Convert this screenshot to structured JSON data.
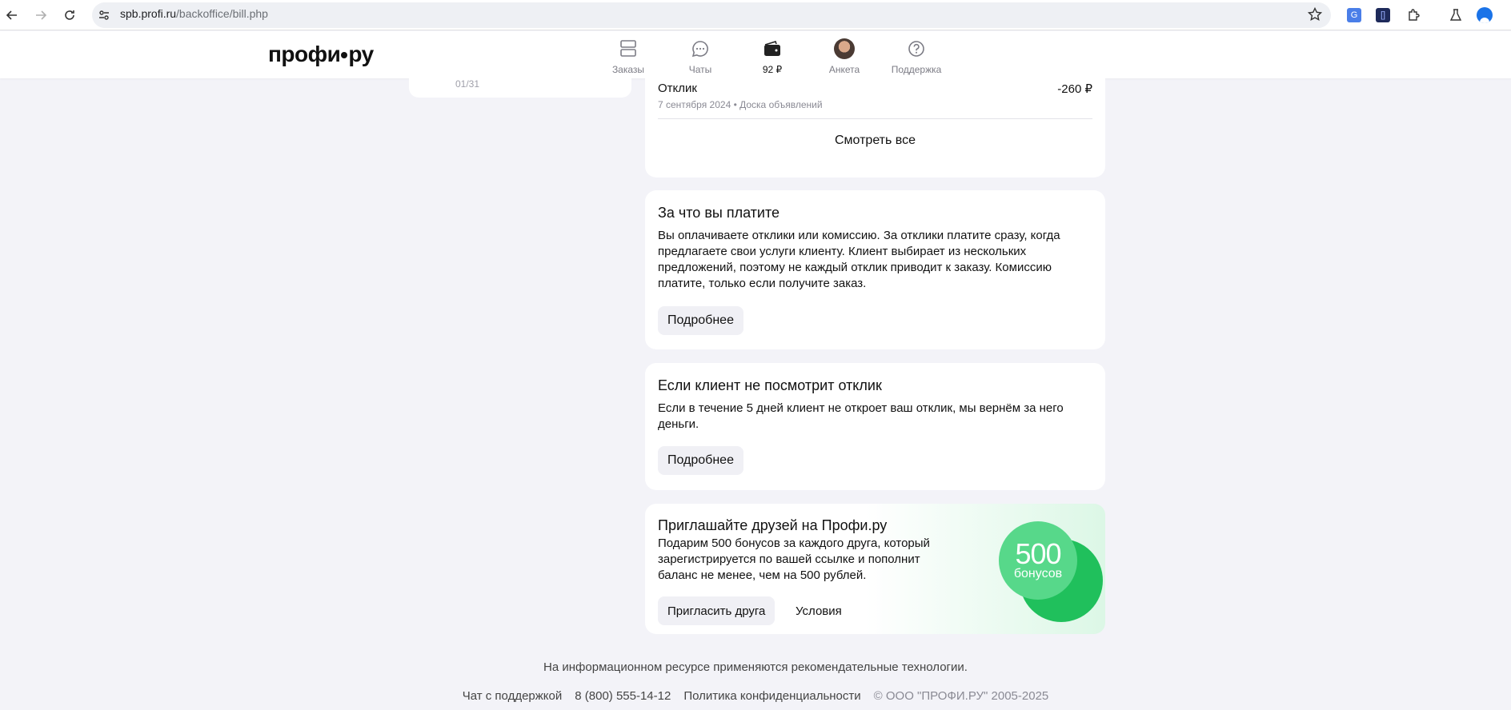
{
  "browser": {
    "url_host": "spb.profi.ru",
    "url_path": "/backoffice/bill.php"
  },
  "header": {
    "logo": "профи.ру",
    "nav": [
      {
        "label": "Заказы",
        "icon": "orders-icon"
      },
      {
        "label": "Чаты",
        "icon": "chat-icon"
      },
      {
        "label": "92 ₽",
        "icon": "wallet-icon"
      },
      {
        "label": "Анкета",
        "icon": "avatar"
      },
      {
        "label": "Поддержка",
        "icon": "help-icon"
      }
    ]
  },
  "left_card": {
    "small_text": "01/31"
  },
  "transactions": {
    "item": {
      "title": "Отклик",
      "amount": "-260 ₽",
      "subtitle": "7 сентября 2024 • Доска объявлений"
    },
    "see_all": "Смотреть все"
  },
  "pay_card": {
    "title": "За что вы платите",
    "body": "Вы оплачиваете отклики или комиссию. За отклики платите сразу, когда предлагаете свои услуги клиенту. Клиент выбирает из нескольких предложений, поэтому не каждый отклик приводит к заказу. Комиссию платите, только если получите заказ.",
    "button": "Подробнее"
  },
  "refund_card": {
    "title": "Если клиент не посмотрит отклик",
    "body": "Если в течение 5 дней клиент не откроет ваш отклик, мы вернём за него деньги.",
    "button": "Подробнее"
  },
  "promo_card": {
    "title": "Приглашайте друзей на Профи.ру",
    "body": "Подарим 500 бонусов за каждого друга, который зарегистрируется по вашей ссылке и пополнит баланс не менее, чем на 500 рублей.",
    "invite_button": "Пригласить друга",
    "terms_button": "Условия",
    "badge_number": "500",
    "badge_word": "бонусов"
  },
  "footer": {
    "note": "На информационном ресурсе применяются рекомендательные технологии.",
    "support_chat": "Чат с поддержкой",
    "phone": "8 (800) 555-14-12",
    "privacy": "Политика конфиденциальности",
    "copyright": "© ООО \"ПРОФИ.РУ\" 2005-2025"
  },
  "colors": {
    "accent_green": "#20c05c",
    "light_green": "#57d88a",
    "page_bg": "#f3f3f8"
  }
}
